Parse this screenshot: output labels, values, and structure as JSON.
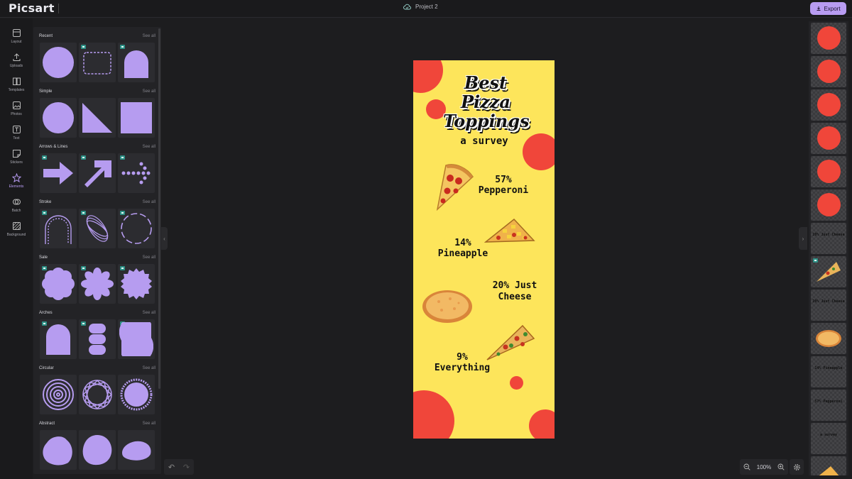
{
  "app": {
    "logo": "Picsart",
    "project_name": "Project 2",
    "export_label": "Export"
  },
  "rail": {
    "items": [
      {
        "label": "Layout",
        "icon": "layout-icon"
      },
      {
        "label": "Uploads",
        "icon": "upload-icon"
      },
      {
        "label": "Templates",
        "icon": "templates-icon"
      },
      {
        "label": "Photos",
        "icon": "photos-icon"
      },
      {
        "label": "Text",
        "icon": "text-icon"
      },
      {
        "label": "Stickers",
        "icon": "stickers-icon"
      },
      {
        "label": "Elements",
        "icon": "star-icon",
        "active": true
      },
      {
        "label": "Batch",
        "icon": "batch-icon"
      },
      {
        "label": "Background",
        "icon": "background-icon"
      }
    ]
  },
  "panel": {
    "see_all": "See all",
    "sections": [
      {
        "title": "Recent"
      },
      {
        "title": "Simple"
      },
      {
        "title": "Arrows & Lines"
      },
      {
        "title": "Stroke"
      },
      {
        "title": "Sale"
      },
      {
        "title": "Arches"
      },
      {
        "title": "Circular"
      },
      {
        "title": "Abstract"
      }
    ]
  },
  "poster": {
    "title_line1": "Best Pizza",
    "title_line2": "Toppings",
    "subtitle": "a survey",
    "stat1_pct": "57%",
    "stat1_name": "Pepperoni",
    "stat2_pct": "14%",
    "stat2_name": "Pineapple",
    "stat3_line1": "20% Just",
    "stat3_line2": "Cheese",
    "stat4_pct": "9%",
    "stat4_name": "Everything"
  },
  "layers": {
    "text1": "20% Just Cheese",
    "text2": "14% Pineapple",
    "text3": "57% Pepperoni",
    "text4": "a survey",
    "text5": "9% Everything"
  },
  "zoom": {
    "level": "100%"
  },
  "colors": {
    "accent": "#b89cf2",
    "poster_bg": "#fde55b",
    "poster_circle": "#f0463a"
  }
}
